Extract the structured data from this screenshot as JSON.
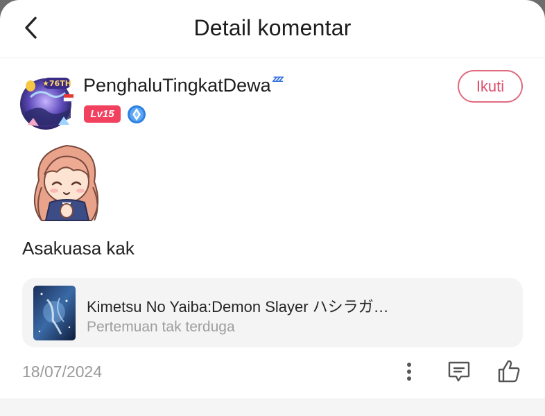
{
  "header": {
    "title": "Detail komentar",
    "back_icon": "chevron-left-icon"
  },
  "comment": {
    "user": {
      "name": "PenghaluTingkatDewa",
      "status_emoji": "zzz-sleep-icon",
      "level": "Lv15",
      "badge_icon": "diamond-badge-icon"
    },
    "follow_label": "Ikuti",
    "text": "Asakuasa kak",
    "date": "18/07/2024"
  },
  "book": {
    "title": "Kimetsu No Yaiba:Demon Slayer ハシラガ…",
    "chapter": "Pertemuan tak terduga"
  },
  "colors": {
    "accent": "#e26a80",
    "level_badge": "#f2415f",
    "badge_blue": "#2d7fe0",
    "muted_text": "#9a9a9a",
    "card_bg": "#f4f4f4"
  }
}
